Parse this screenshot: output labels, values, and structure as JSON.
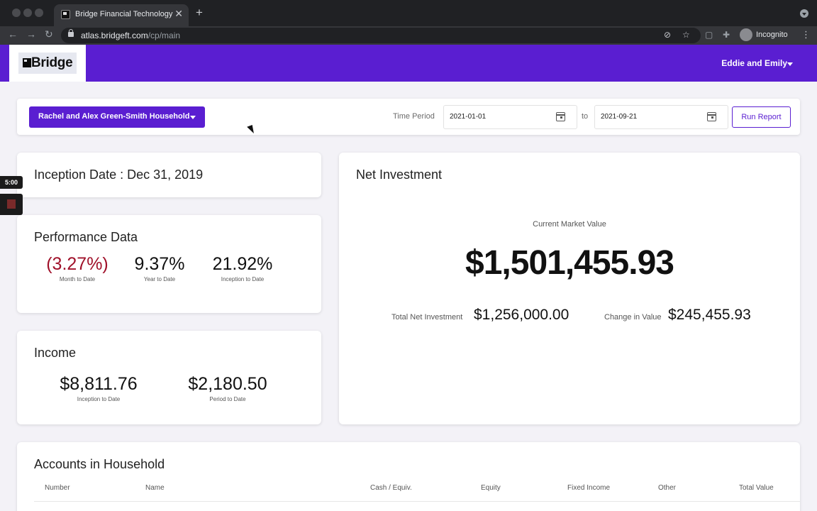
{
  "browser": {
    "tab_title": "Bridge Financial Technology",
    "url_host": "atlas.bridgeft.com",
    "url_path": "/cp/main",
    "profile_label": "Incognito",
    "icons": [
      "back-icon",
      "forward-icon",
      "reload-icon",
      "lock-icon",
      "eye-off-icon",
      "star-icon",
      "extensions-icon",
      "kebab-icon"
    ]
  },
  "header": {
    "logo_text": "Bridge",
    "user_menu_label": "Eddie and Emily",
    "brand_color": "#5a1ed1"
  },
  "filters": {
    "household_label": "Rachel and Alex Green-Smith Household",
    "time_period_label": "Time Period",
    "start_date": "2021-01-01",
    "to_label": "to",
    "end_date": "2021-09-21",
    "run_report_label": "Run Report"
  },
  "inception": {
    "title": "Inception Date : Dec 31, 2019"
  },
  "performance": {
    "title": "Performance Data",
    "metrics": [
      {
        "value": "(3.27%)",
        "label": "Month to Date",
        "color": "#a0112a"
      },
      {
        "value": "9.37%",
        "label": "Year to Date",
        "color": "#111111"
      },
      {
        "value": "21.92%",
        "label": "Inception to Date",
        "color": "#111111"
      }
    ]
  },
  "income": {
    "title": "Income",
    "metrics": [
      {
        "value": "$8,811.76",
        "label": "Inception to Date"
      },
      {
        "value": "$2,180.50",
        "label": "Period to Date"
      }
    ]
  },
  "net_investment": {
    "title": "Net Investment",
    "market_value_label": "Current Market Value",
    "market_value": "$1,501,455.93",
    "total_net_label": "Total Net Investment",
    "total_net_value": "$1,256,000.00",
    "change_label": "Change in Value",
    "change_value": "$245,455.93"
  },
  "accounts": {
    "title": "Accounts in Household",
    "columns": [
      "Number",
      "Name",
      "Cash / Equiv.",
      "Equity",
      "Fixed Income",
      "Other",
      "Total Value"
    ]
  },
  "recorder": {
    "time": "5:00"
  }
}
